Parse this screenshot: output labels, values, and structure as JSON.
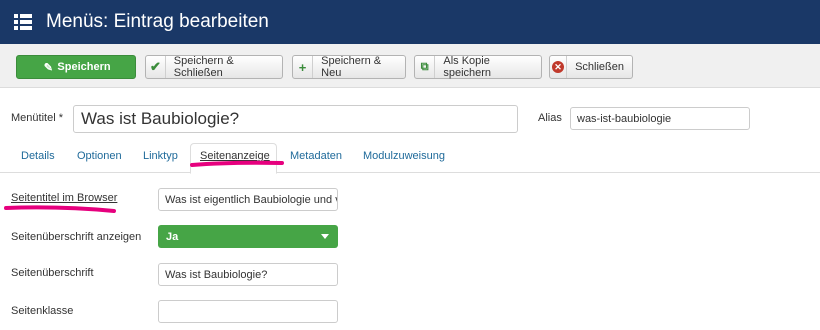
{
  "header": {
    "title": "Menüs: Eintrag bearbeiten",
    "icon": "list-menu-icon"
  },
  "toolbar": {
    "save": "Speichern",
    "save_close": "Speichern & Schließen",
    "save_new": "Speichern & Neu",
    "save_copy": "Als Kopie speichern",
    "close": "Schließen"
  },
  "form": {
    "title_label": "Menütitel *",
    "title_value": "Was ist Baubiologie?",
    "alias_label": "Alias",
    "alias_value": "was-ist-baubiologie"
  },
  "tabs": [
    "Details",
    "Optionen",
    "Linktyp",
    "Seitenanzeige",
    "Metadaten",
    "Modulzuweisung"
  ],
  "active_tab": "Seitenanzeige",
  "page_display": {
    "browser_title_label": "Seitentitel im Browser",
    "browser_title_value": "Was ist eigentlich Baubiologie und v",
    "show_heading_label": "Seitenüberschrift anzeigen",
    "show_heading_value": "Ja",
    "heading_label": "Seitenüberschrift",
    "heading_value": "Was ist Baubiologie?",
    "page_class_label": "Seitenklasse",
    "page_class_value": ""
  },
  "colors": {
    "header": "#1a3867",
    "success": "#46a546",
    "link": "#1f6a9a",
    "highlight": "#e6007e"
  }
}
